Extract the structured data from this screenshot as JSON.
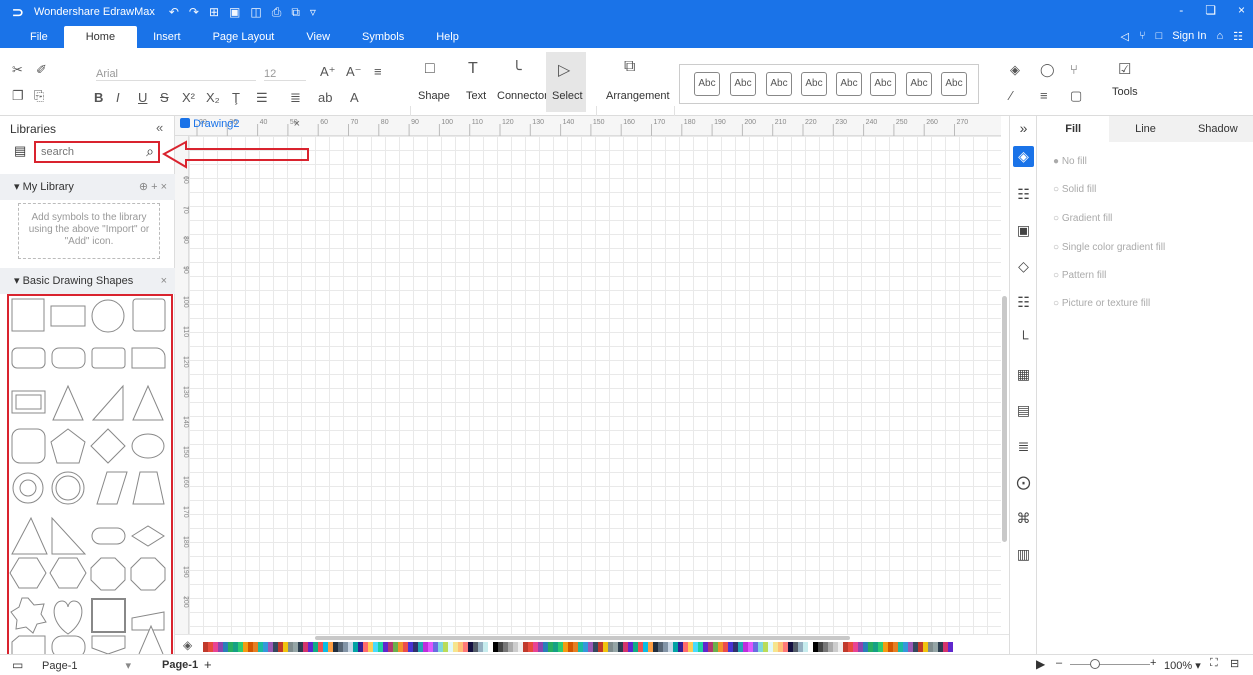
{
  "app": {
    "title": "Wondershare EdrawMax",
    "window_controls": [
      "-",
      "❏",
      "×"
    ]
  },
  "quick_access": [
    "↶",
    "↷",
    "⊞",
    "▣",
    "◫",
    "⎙",
    "⧉",
    "▿"
  ],
  "menu_tabs": [
    {
      "label": "File",
      "active": false
    },
    {
      "label": "Home",
      "active": true
    },
    {
      "label": "Insert",
      "active": false
    },
    {
      "label": "Page Layout",
      "active": false
    },
    {
      "label": "View",
      "active": false
    },
    {
      "label": "Symbols",
      "active": false
    },
    {
      "label": "Help",
      "active": false
    }
  ],
  "titlebar_right": {
    "sign_in": "Sign In"
  },
  "ribbon": {
    "font_name": "Arial",
    "font_size": "12",
    "shape_label": "Shape",
    "text_label": "Text",
    "connector_label": "Connector",
    "select_label": "Select",
    "arrangement_label": "Arrangement",
    "style_samples": [
      "Abc",
      "Abc",
      "Abc",
      "Abc",
      "Abc",
      "Abc",
      "Abc",
      "Abc"
    ],
    "tools_label": "Tools"
  },
  "libraries": {
    "title": "Libraries",
    "search_placeholder": "search",
    "my_library": {
      "title": "My Library",
      "hint": "Add symbols to the library using the above \"Import\" or \"Add\" icon."
    },
    "basic_shapes": {
      "title": "Basic Drawing Shapes"
    }
  },
  "document": {
    "tab_title": "Drawing2"
  },
  "rulers": {
    "h_ticks": [
      "20",
      "30",
      "40",
      "50",
      "60",
      "70",
      "80",
      "90",
      "100",
      "110",
      "120",
      "130",
      "140",
      "150",
      "160",
      "170",
      "180",
      "190",
      "200",
      "210",
      "220",
      "230",
      "240",
      "250",
      "260",
      "270"
    ],
    "v_ticks": [
      "60",
      "70",
      "80",
      "90",
      "100",
      "110",
      "120",
      "130",
      "140",
      "150",
      "160",
      "170",
      "180",
      "190",
      "200"
    ]
  },
  "format_panel": {
    "tabs": [
      "Fill",
      "Line",
      "Shadow"
    ],
    "active_tab": "Fill",
    "fill_options": [
      "No fill",
      "Solid fill",
      "Gradient fill",
      "Single color gradient fill",
      "Pattern fill",
      "Picture or texture fill"
    ]
  },
  "status": {
    "page_select": "Page-1",
    "page_tab": "Page-1",
    "add_page": "+",
    "zoom": "100%"
  },
  "colors": {
    "accent": "#1a73e8",
    "highlight": "#d9232e"
  }
}
